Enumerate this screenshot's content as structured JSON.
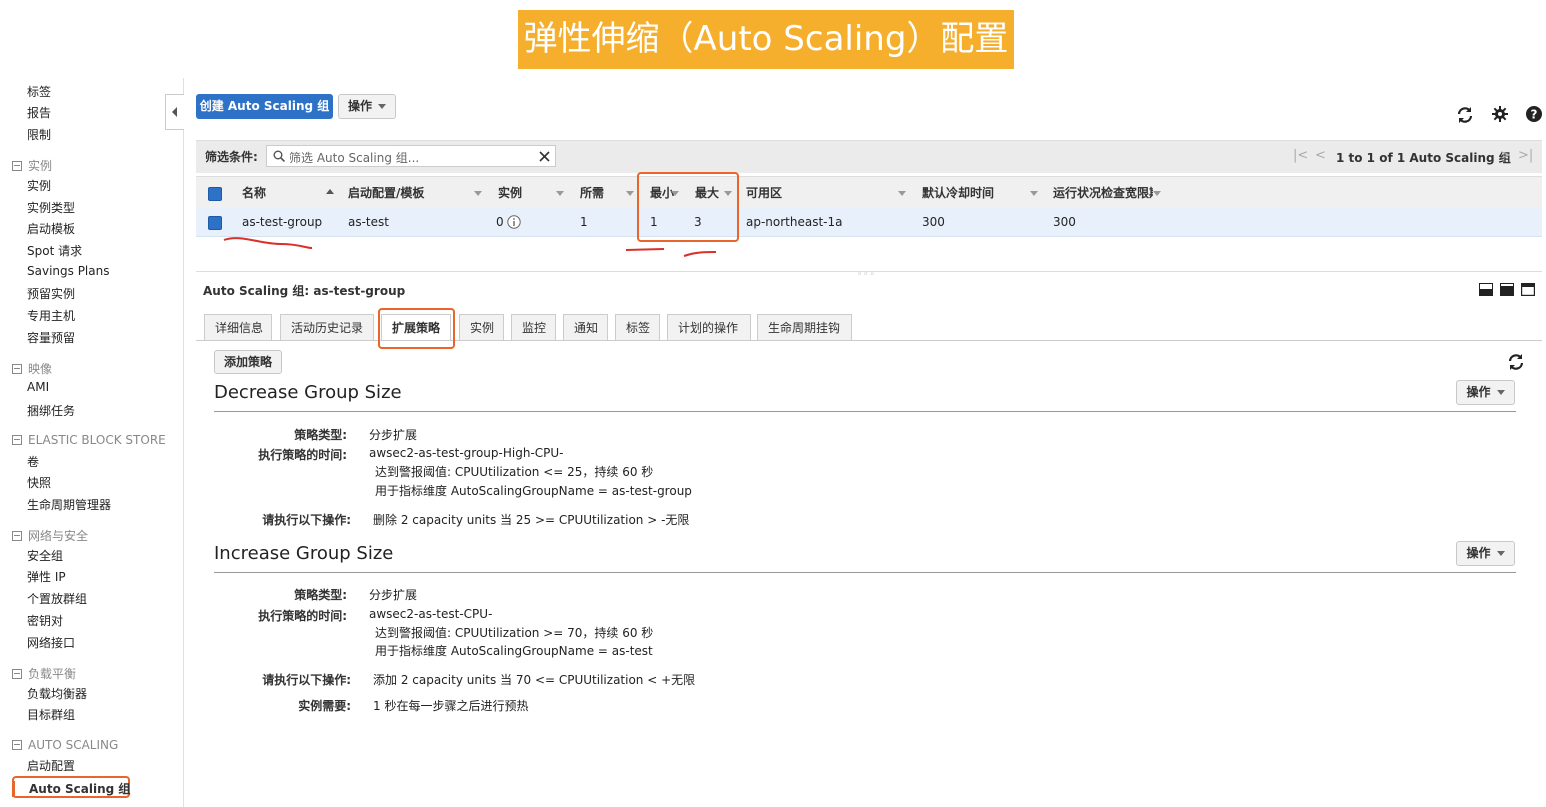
{
  "banner": {
    "title": "弹性伸缩（Auto Scaling）配置"
  },
  "sidebar": {
    "top_items": [
      "标签",
      "报告",
      "限制"
    ],
    "sections": [
      {
        "title": "实例",
        "items": [
          "实例",
          "实例类型",
          "启动模板",
          "Spot 请求",
          "Savings Plans",
          "预留实例",
          "专用主机",
          "容量预留"
        ]
      },
      {
        "title": "映像",
        "items": [
          "AMI",
          "捆绑任务"
        ]
      },
      {
        "title": "ELASTIC BLOCK STORE",
        "items": [
          "卷",
          "快照",
          "生命周期管理器"
        ]
      },
      {
        "title": "网络与安全",
        "items": [
          "安全组",
          "弹性 IP",
          "个置放群组",
          "密钥对",
          "网络接口"
        ]
      },
      {
        "title": "负载平衡",
        "items": [
          "负载均衡器",
          "目标群组"
        ]
      },
      {
        "title": "AUTO SCALING",
        "items": [
          "启动配置"
        ]
      }
    ],
    "active_item": "Auto Scaling 组"
  },
  "toolbar": {
    "create_label": "创建 Auto Scaling 组",
    "actions_label": "操作"
  },
  "filter": {
    "label": "筛选条件:",
    "placeholder": "筛选 Auto Scaling 组...",
    "pagination": "1 to 1 of 1 Auto Scaling 组"
  },
  "table": {
    "columns": [
      "名称",
      "启动配置/模板",
      "实例",
      "所需",
      "最小",
      "最大",
      "可用区",
      "默认冷却时间",
      "运行状况检查宽限期"
    ],
    "row": {
      "name": "as-test-group",
      "launch": "as-test",
      "instances": "0",
      "desired": "1",
      "min": "1",
      "max": "3",
      "az": "ap-northeast-1a",
      "cooldown": "300",
      "grace": "300"
    }
  },
  "detail": {
    "title": "Auto Scaling 组: as-test-group",
    "tabs": [
      "详细信息",
      "活动历史记录",
      "扩展策略",
      "实例",
      "监控",
      "通知",
      "标签",
      "计划的操作",
      "生命周期挂钩"
    ],
    "active_tab": "扩展策略",
    "add_policy_label": "添加策略",
    "actions_label": "操作",
    "policies": [
      {
        "name": "Decrease Group Size",
        "type_label": "策略类型:",
        "type": "分步扩展",
        "exec_label": "执行策略的时间:",
        "alarm": "awsec2-as-test-group-High-CPU-",
        "threshold": "达到警报阈值: CPUUtilization <= 25，持续 60 秒",
        "dimension": "用于指标维度 AutoScalingGroupName = as-test-group",
        "action_label": "请执行以下操作:",
        "action": "删除 2 capacity units 当 25 >= CPUUtilization > -无限"
      },
      {
        "name": "Increase Group Size",
        "type_label": "策略类型:",
        "type": "分步扩展",
        "exec_label": "执行策略的时间:",
        "alarm": "awsec2-as-test-CPU-",
        "threshold": "达到警报阈值: CPUUtilization >= 70，持续 60 秒",
        "dimension": "用于指标维度 AutoScalingGroupName = as-test",
        "action_label": "请执行以下操作:",
        "action": "添加 2 capacity units 当 70 <= CPUUtilization < +无限",
        "warmup_label": "实例需要:",
        "warmup": "1 秒在每一步骤之后进行预热"
      }
    ]
  },
  "colors": {
    "accent": "#2d72c7",
    "highlight": "#e8662b",
    "banner": "#f6ae2d",
    "annotation": "#d9302a"
  }
}
